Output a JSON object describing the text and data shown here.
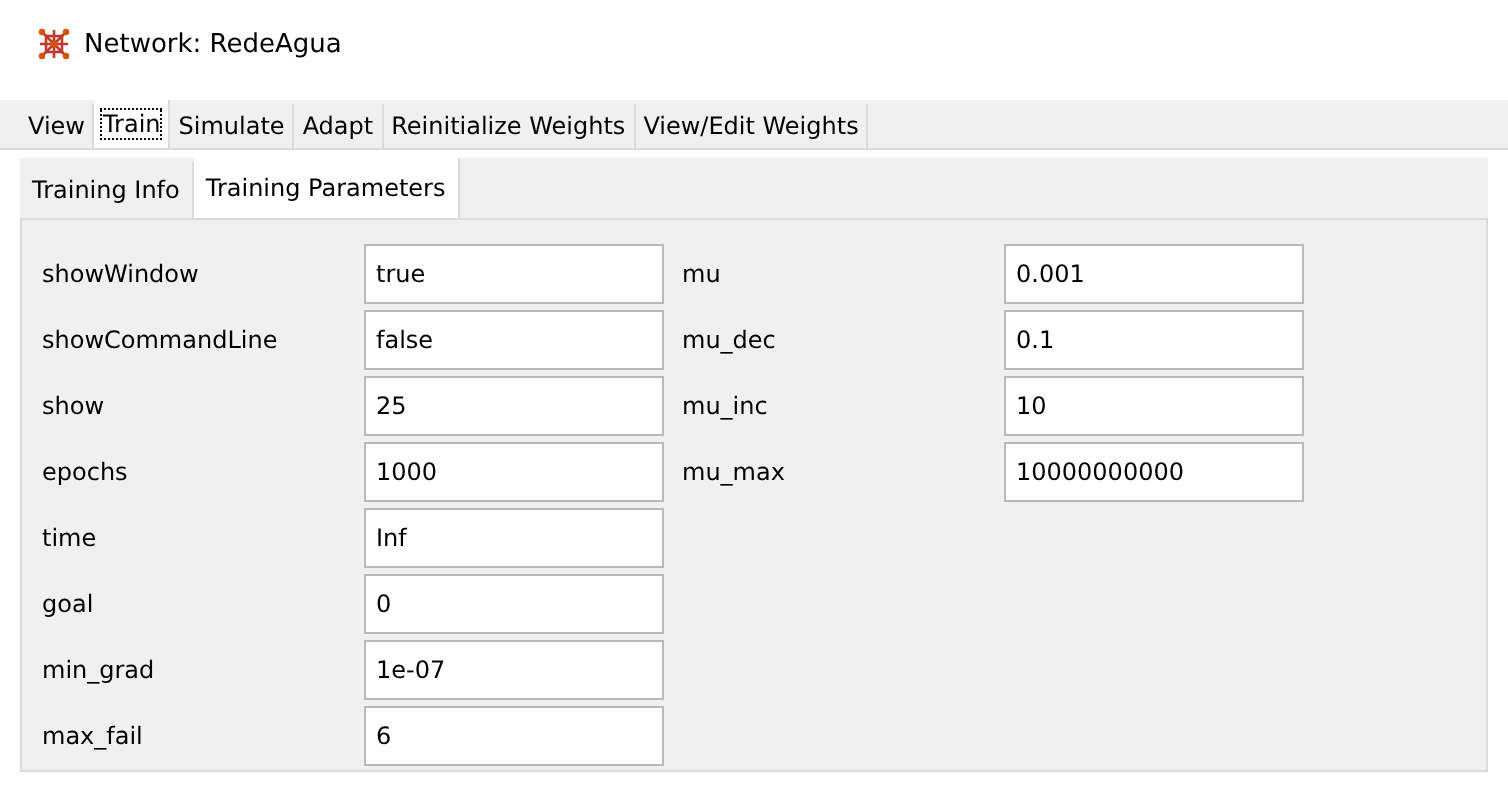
{
  "window": {
    "title": "Network: RedeAgua"
  },
  "tabs": [
    {
      "label": "View",
      "selected": false
    },
    {
      "label": "Train",
      "selected": true
    },
    {
      "label": "Simulate",
      "selected": false
    },
    {
      "label": "Adapt",
      "selected": false
    },
    {
      "label": "Reinitialize Weights",
      "selected": false
    },
    {
      "label": "View/Edit Weights",
      "selected": false
    }
  ],
  "subtabs": [
    {
      "label": "Training Info",
      "selected": false
    },
    {
      "label": "Training Parameters",
      "selected": true
    }
  ],
  "parameters": [
    [
      {
        "label": "showWindow",
        "value": "true"
      },
      {
        "label": "showCommandLine",
        "value": "false"
      },
      {
        "label": "show",
        "value": "25"
      },
      {
        "label": "epochs",
        "value": "1000"
      },
      {
        "label": "time",
        "value": "Inf"
      },
      {
        "label": "goal",
        "value": "0"
      },
      {
        "label": "min_grad",
        "value": "1e-07"
      },
      {
        "label": "max_fail",
        "value": "6"
      }
    ],
    [
      {
        "label": "mu",
        "value": "0.001"
      },
      {
        "label": "mu_dec",
        "value": "0.1"
      },
      {
        "label": "mu_inc",
        "value": "10"
      },
      {
        "label": "mu_max",
        "value": "10000000000"
      }
    ]
  ]
}
